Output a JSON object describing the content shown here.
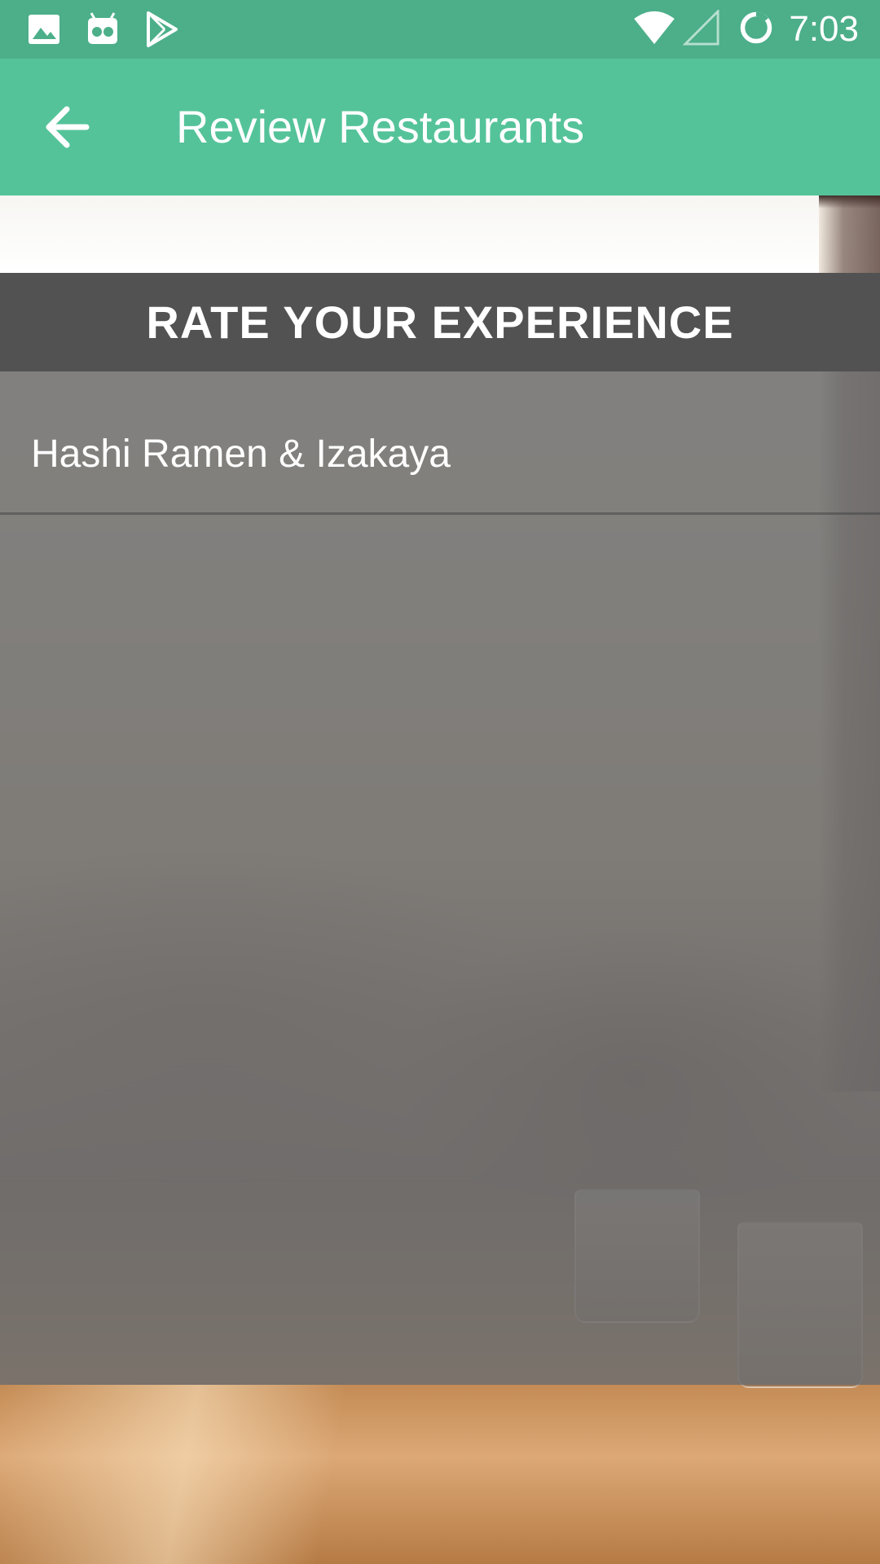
{
  "status_bar": {
    "time": "7:03",
    "left_icons": [
      "image-icon",
      "android-debug-icon",
      "play-store-icon"
    ],
    "right_icons": [
      "wifi-icon",
      "cell-signal-icon",
      "sync-progress-icon"
    ]
  },
  "toolbar": {
    "title": "Review Restaurants",
    "back_icon": "arrow-back-icon"
  },
  "rate_section": {
    "header": "RATE YOUR EXPERIENCE",
    "restaurants": [
      {
        "name": "Hashi Ramen & Izakaya"
      }
    ]
  },
  "colors": {
    "status_bar": "#4caf8a",
    "toolbar": "#55c39a",
    "header_bg": "#525252",
    "overlay": "#707070"
  }
}
